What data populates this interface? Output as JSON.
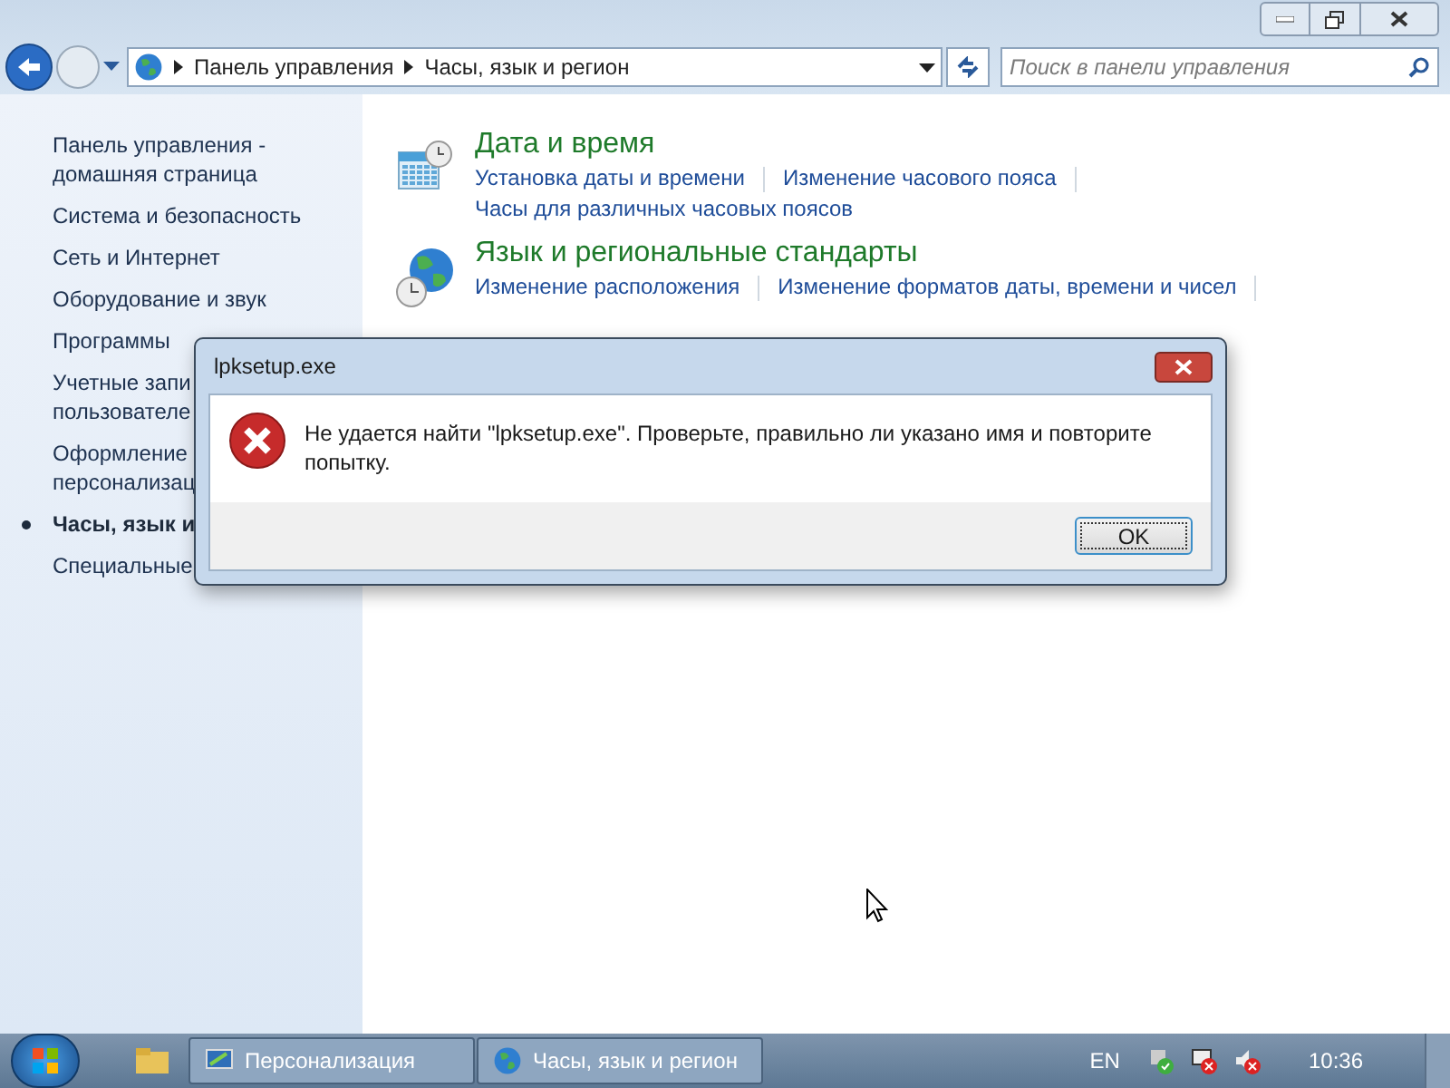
{
  "address_bar": {
    "path": [
      {
        "label": "Панель управления"
      },
      {
        "label": "Часы, язык и регион"
      }
    ]
  },
  "search": {
    "placeholder": "Поиск в панели управления"
  },
  "sidebar": {
    "items": [
      {
        "lines": [
          "Панель управления -",
          "домашняя страница"
        ],
        "selected": false
      },
      {
        "lines": [
          "Система и безопасность"
        ],
        "selected": false
      },
      {
        "lines": [
          "Сеть и Интернет"
        ],
        "selected": false
      },
      {
        "lines": [
          "Оборудование и звук"
        ],
        "selected": false
      },
      {
        "lines": [
          "Программы"
        ],
        "selected": false
      },
      {
        "lines": [
          "Учетные запи",
          "пользователе"
        ],
        "selected": false
      },
      {
        "lines": [
          "Оформление",
          "персонализац"
        ],
        "selected": false
      },
      {
        "lines": [
          "Часы, язык и"
        ],
        "selected": true
      },
      {
        "lines": [
          "Специальные"
        ],
        "selected": false
      }
    ]
  },
  "sections": [
    {
      "kind": "calendar",
      "title": "Дата и время",
      "link_rows": [
        [
          "Установка даты и времени",
          "Изменение часового пояса"
        ],
        [
          "Часы для различных часовых поясов"
        ]
      ]
    },
    {
      "kind": "globe",
      "title": "Язык и региональные стандарты",
      "link_rows": [
        [
          "Изменение расположения",
          "Изменение форматов даты, времени и чисел"
        ]
      ]
    }
  ],
  "dialog": {
    "title": "lpksetup.exe",
    "message_lines": [
      "Не удается найти \"lpksetup.exe\". Проверьте, правильно ли указано имя и повторите",
      "попытку."
    ],
    "buttons": [
      "OK"
    ]
  },
  "taskbar": {
    "items": [
      {
        "label": "Персонализация",
        "kind": "paint"
      },
      {
        "label": "Часы, язык и регион",
        "kind": "globe"
      }
    ],
    "language": "EN",
    "clock": "10:36"
  }
}
